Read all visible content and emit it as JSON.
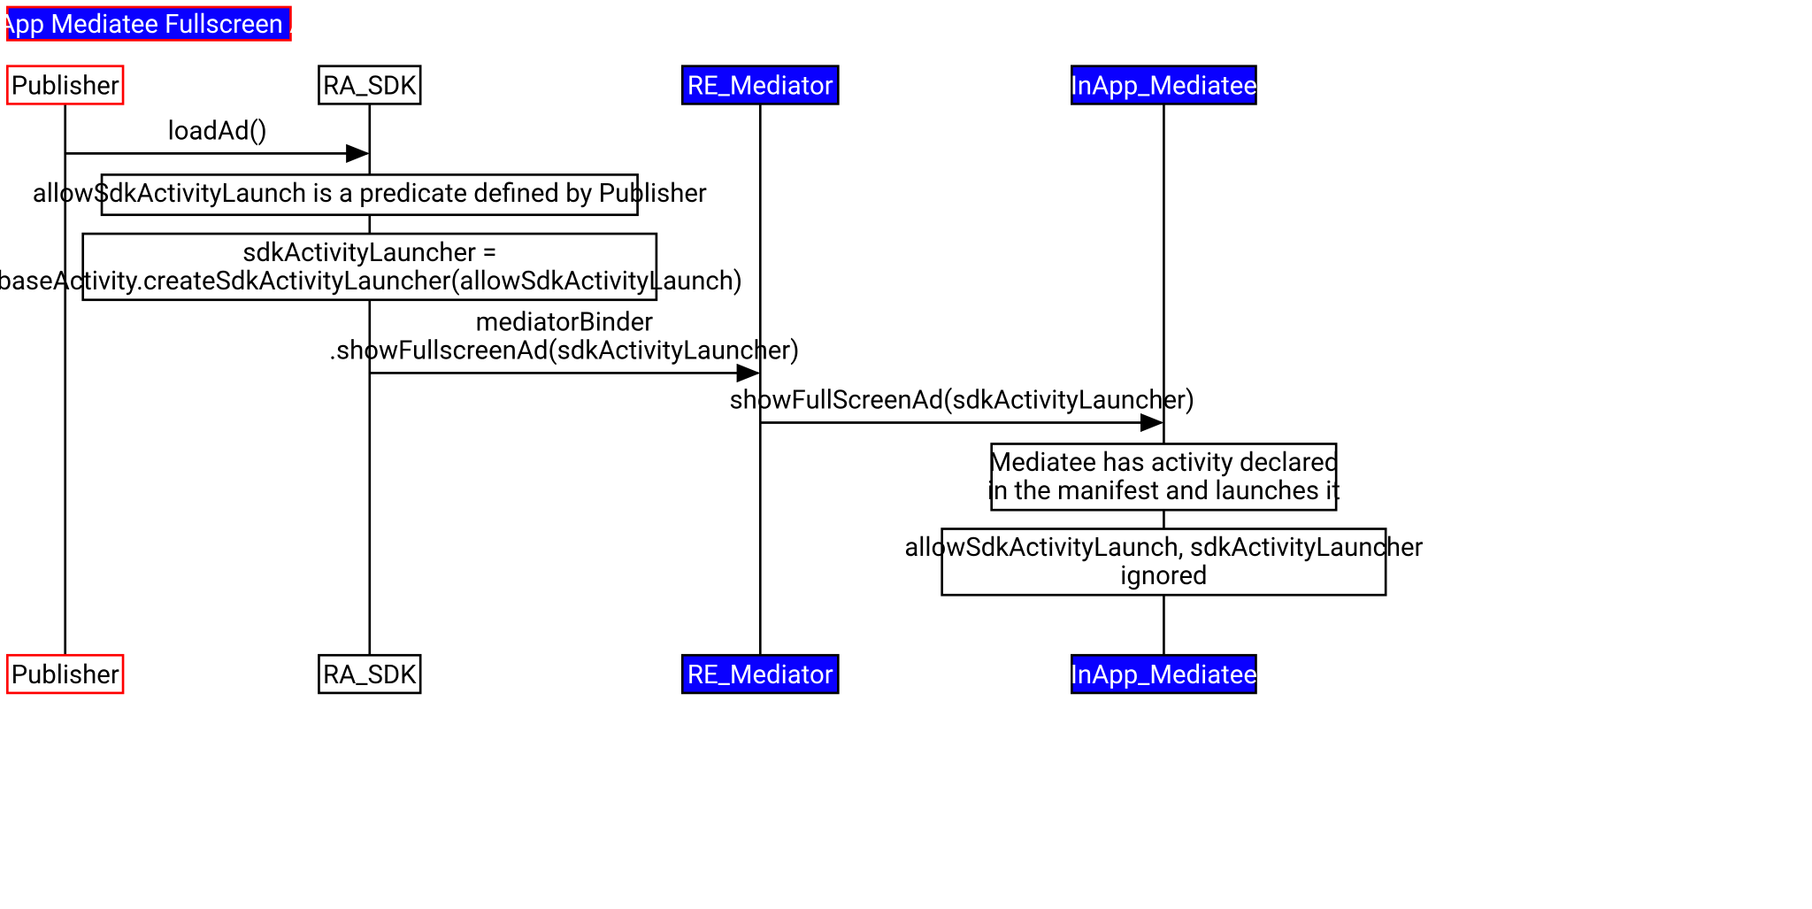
{
  "title": "InApp Mediatee Fullscreen Ad",
  "actors": {
    "publisher": "Publisher",
    "ra_sdk": "RA_SDK",
    "re_mediator": "RE_Mediator",
    "inapp_mediatee": "InApp_Mediatee"
  },
  "messages": {
    "m1": "loadAd()",
    "m2_l1": "mediatorBinder",
    "m2_l2": ".showFullscreenAd(sdkActivityLauncher)",
    "m3": "showFullScreenAd(sdkActivityLauncher)"
  },
  "notes": {
    "n1": "allowSdkActivityLaunch is a predicate defined by Publisher",
    "n2_l1": "sdkActivityLauncher =",
    "n2_l2": "baseActivity.createSdkActivityLauncher(allowSdkActivityLaunch)",
    "n3_l1": "Mediatee has activity declared",
    "n3_l2": "in the manifest and launches it",
    "n4_l1": "allowSdkActivityLaunch, sdkActivityLauncher",
    "n4_l2": "ignored"
  }
}
